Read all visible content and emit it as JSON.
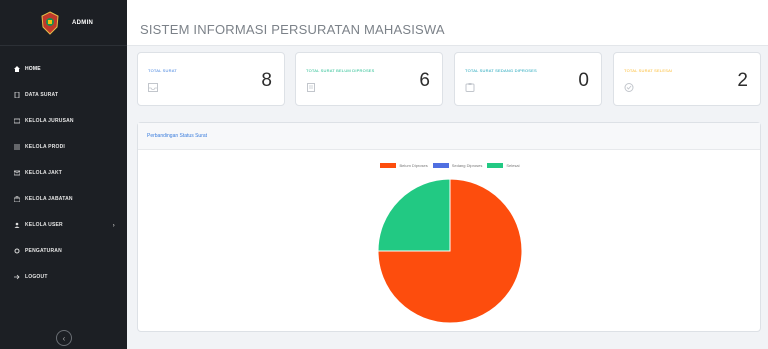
{
  "sidebar": {
    "brand": "ADMIN",
    "items": [
      {
        "label": "HOME",
        "icon": "home-icon",
        "active": true
      },
      {
        "label": "DATA SURAT",
        "icon": "file-icon"
      },
      {
        "label": "KELOLA JURUSAN",
        "icon": "folder-icon"
      },
      {
        "label": "KELOLA PRODI",
        "icon": "list-icon"
      },
      {
        "label": "KELOLA JAKT",
        "icon": "envelope-icon"
      },
      {
        "label": "KELOLA JABATAN",
        "icon": "briefcase-icon"
      },
      {
        "label": "KELOLA USER",
        "icon": "users-icon",
        "has_submenu": true
      },
      {
        "label": "PENGATURAN",
        "icon": "gear-icon"
      },
      {
        "label": "LOGOUT",
        "icon": "logout-icon"
      }
    ]
  },
  "header": {
    "title": "SISTEM INFORMASI PERSURATAN MAHASISWA"
  },
  "cards": [
    {
      "label": "TOTAL SURAT",
      "value": "8",
      "color": "#3b7ddd",
      "icon": "inbox-icon"
    },
    {
      "label": "TOTAL SURAT BELUM DIPROSES",
      "value": "6",
      "color": "#1cbb8c",
      "icon": "document-icon"
    },
    {
      "label": "TOTAL SURAT SEDANG DIPROSES",
      "value": "0",
      "color": "#17a2b8",
      "icon": "clipboard-icon"
    },
    {
      "label": "TOTAL SURAT SELESAI",
      "value": "2",
      "color": "#fcb92c",
      "icon": "check-icon"
    }
  ],
  "chart_panel": {
    "title": "Perbandingan Status Surat"
  },
  "chart_data": {
    "type": "pie",
    "series": [
      {
        "name": "Belum Diproses",
        "value": 6,
        "color": "#fd4d0d"
      },
      {
        "name": "Sedang Diproses",
        "value": 0,
        "color": "#4f6fe1"
      },
      {
        "name": "Selesai",
        "value": 2,
        "color": "#22c983"
      }
    ],
    "legend": "top-center"
  }
}
